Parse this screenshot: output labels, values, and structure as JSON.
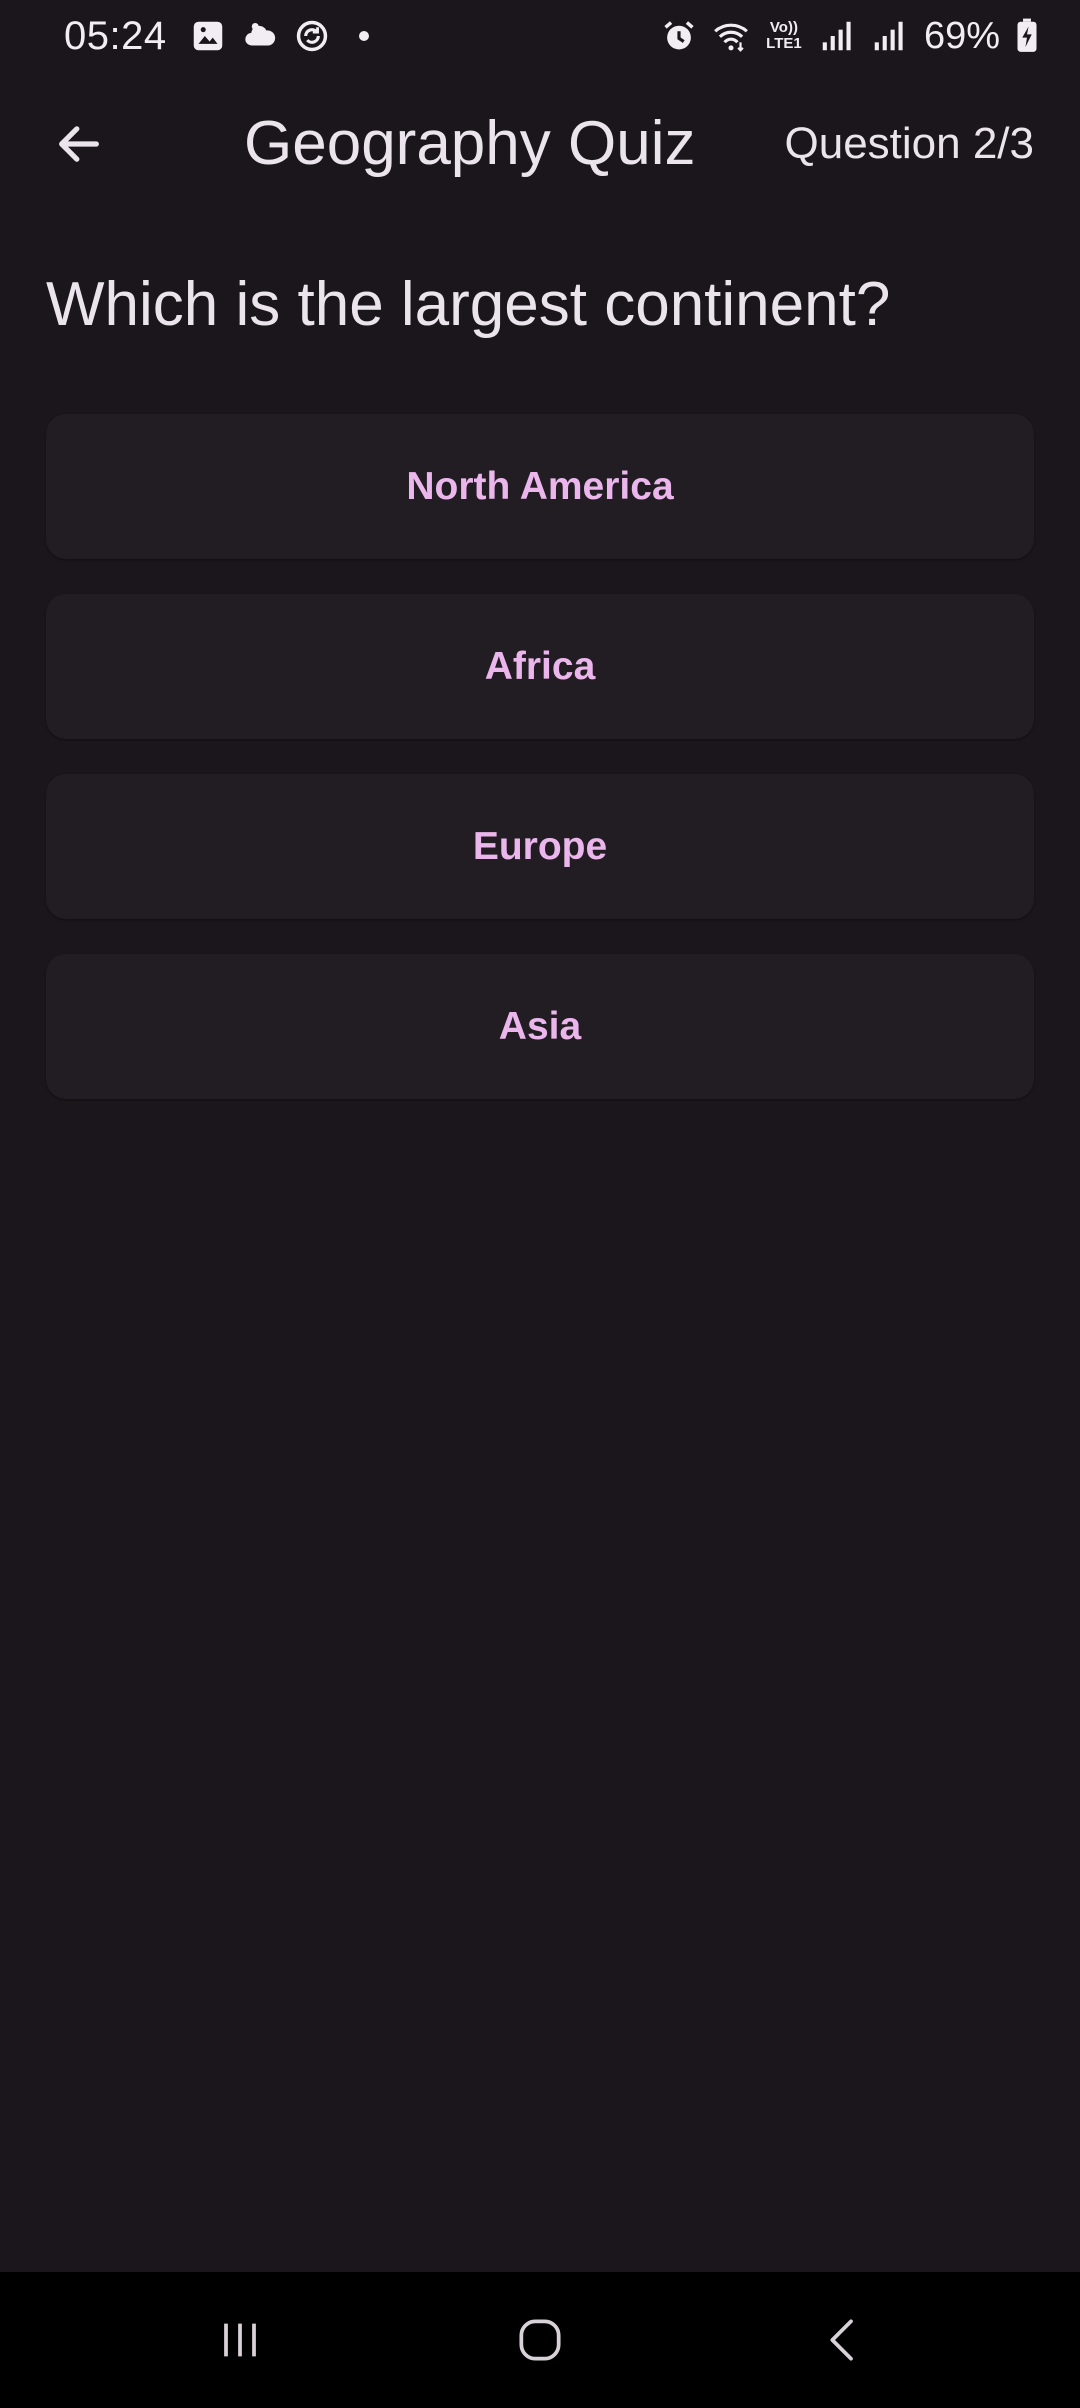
{
  "status_bar": {
    "time": "05:24",
    "left_icons": [
      "gallery-icon",
      "cloud-icon",
      "sync-icon",
      "notification-dot"
    ],
    "right_icons": [
      "alarm-icon",
      "wifi-icon",
      "volte-icon",
      "signal-icon",
      "signal-icon",
      "battery-charging-icon"
    ],
    "volte_line1": "Vo))",
    "volte_line2": "LTE1",
    "battery": "69%"
  },
  "app_bar": {
    "back_icon": "arrow-left-icon",
    "title": "Geography Quiz",
    "question_counter": "Question 2/3"
  },
  "quiz": {
    "question": "Which is the largest continent?",
    "answers": [
      "North America",
      "Africa",
      "Europe",
      "Asia"
    ]
  },
  "nav_bar": {
    "icons": [
      "recents-icon",
      "home-icon",
      "back-icon"
    ]
  },
  "colors": {
    "background": "#1a161b",
    "answer_background": "#211d23",
    "answer_text": "#eab6eb",
    "primary_text": "#ece4ec",
    "nav_background": "#000000"
  }
}
